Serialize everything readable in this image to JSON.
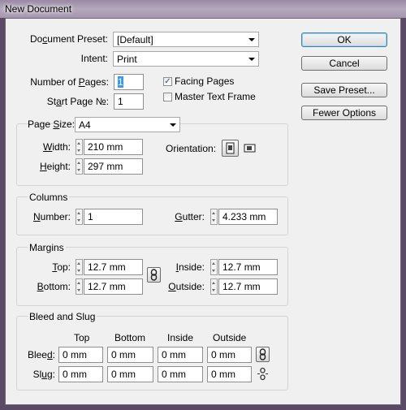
{
  "window": {
    "title": "New Document"
  },
  "preset": {
    "label_pre": "Do",
    "label_key": "c",
    "label_post": "ument Preset:",
    "value": "[Default]"
  },
  "intent": {
    "label": "Intent:",
    "value": "Print"
  },
  "pages": {
    "number_label_pre": "Number of ",
    "number_label_key": "P",
    "number_label_post": "ages:",
    "number_value": "1",
    "start_label_pre": "St",
    "start_label_key": "a",
    "start_label_post": "rt Page №:",
    "start_value": "1",
    "facing_label": "Facing Pages",
    "facing_checked": true,
    "master_label": "Master Text Frame",
    "master_checked": false
  },
  "page_size": {
    "label_pre": "Page ",
    "label_key": "S",
    "label_post": "ize:",
    "value": "A4",
    "width_key": "W",
    "width_rest": "idth:",
    "width_value": "210 mm",
    "height_key": "H",
    "height_rest": "eight:",
    "height_value": "297 mm",
    "orientation_label": "Orientation:"
  },
  "columns": {
    "group_label": "Columns",
    "number_key": "N",
    "number_rest": "umber:",
    "number_value": "1",
    "gutter_key": "G",
    "gutter_rest": "utter:",
    "gutter_value": "4.233 mm"
  },
  "margins": {
    "group_label": "Margins",
    "top_key": "T",
    "top_rest": "op:",
    "top_value": "12.7 mm",
    "bottom_key": "B",
    "bottom_rest": "ottom:",
    "bottom_value": "12.7 mm",
    "inside_key": "I",
    "inside_rest": "nside:",
    "inside_value": "12.7 mm",
    "outside_key": "O",
    "outside_rest": "utside:",
    "outside_value": "12.7 mm"
  },
  "bleed_slug": {
    "group_label": "Bleed and Slug",
    "headers": [
      "Top",
      "Bottom",
      "Inside",
      "Outside"
    ],
    "bleed_pre": "Blee",
    "bleed_key": "d",
    "bleed_post": ":",
    "slug_pre": "Sl",
    "slug_key": "u",
    "slug_post": "g:",
    "bleed_values": [
      "0 mm",
      "0 mm",
      "0 mm",
      "0 mm"
    ],
    "slug_values": [
      "0 mm",
      "0 mm",
      "0 mm",
      "0 mm"
    ]
  },
  "buttons": {
    "ok": "OK",
    "cancel": "Cancel",
    "save_preset": "Save Preset...",
    "fewer_options": "Fewer Options"
  },
  "colors": {
    "title_bg": "#a596ae",
    "dialog_bg": "#f0f0f0",
    "default_button_border": "#3c7fb1"
  }
}
